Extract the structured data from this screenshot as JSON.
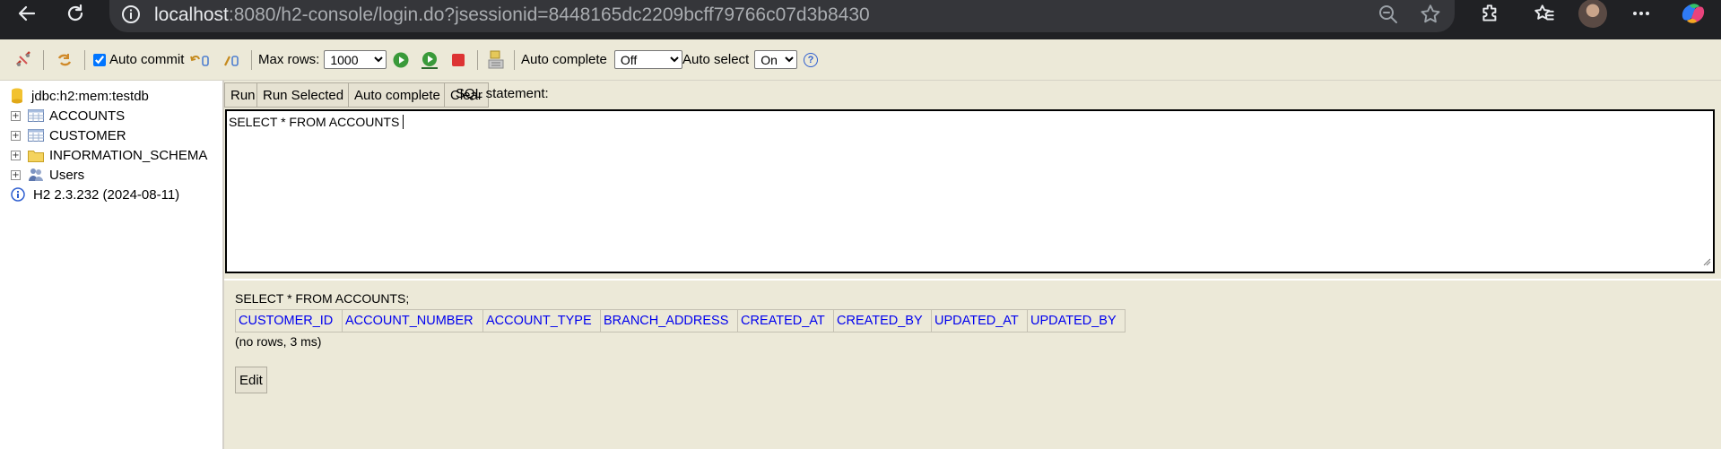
{
  "browser": {
    "url_host": "localhost",
    "url_rest": ":8080/h2-console/login.do?jsessionid=8448165dc2209bcff79766c07d3b8430",
    "icons": [
      "back-icon",
      "refresh-icon",
      "info-icon",
      "zoom-out-icon",
      "star-icon",
      "extensions-icon",
      "favorites-icon",
      "profile-avatar",
      "more-icon",
      "copilot-icon"
    ]
  },
  "toolbar": {
    "auto_commit_label": "Auto commit",
    "auto_commit_checked": true,
    "max_rows_label": "Max rows:",
    "max_rows_value": "1000",
    "auto_complete_label": "Auto complete",
    "auto_complete_value": "Off",
    "auto_select_label": "Auto select",
    "auto_select_value": "On",
    "help_label": "?"
  },
  "tree": {
    "connection": "jdbc:h2:mem:testdb",
    "items": [
      {
        "label": "ACCOUNTS",
        "icon": "table-icon"
      },
      {
        "label": "CUSTOMER",
        "icon": "table-icon"
      },
      {
        "label": "INFORMATION_SCHEMA",
        "icon": "folder-icon"
      },
      {
        "label": "Users",
        "icon": "users-icon"
      }
    ],
    "version": "H2 2.3.232 (2024-08-11)"
  },
  "query": {
    "run_label": "Run",
    "run_selected_label": "Run Selected",
    "auto_complete_label": "Auto complete",
    "clear_label": "Clear",
    "sql_statement_label": "SQL statement:",
    "sql_text": "SELECT * FROM ACCOUNTS"
  },
  "result": {
    "sql": "SELECT * FROM ACCOUNTS;",
    "columns": [
      "CUSTOMER_ID",
      "ACCOUNT_NUMBER",
      "ACCOUNT_TYPE",
      "BRANCH_ADDRESS",
      "CREATED_AT",
      "CREATED_BY",
      "UPDATED_AT",
      "UPDATED_BY"
    ],
    "status": "(no rows, 3 ms)",
    "edit_label": "Edit"
  },
  "colors": {
    "panel_bg": "#ece9d8",
    "chrome_bg": "#202124",
    "link_blue": "#0000ee"
  }
}
